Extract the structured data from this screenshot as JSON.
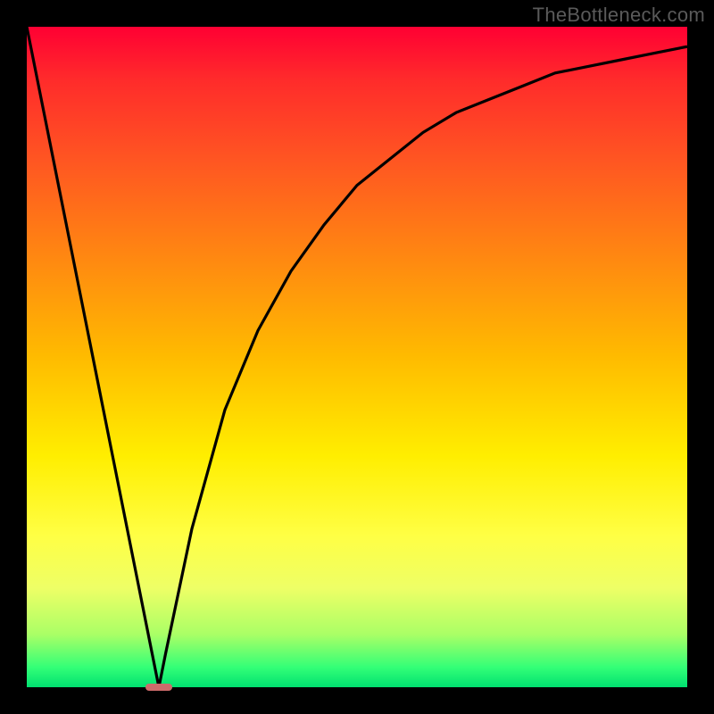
{
  "watermark": "TheBottleneck.com",
  "chart_data": {
    "type": "line",
    "title": "",
    "xlabel": "",
    "ylabel": "",
    "xlim": [
      0,
      100
    ],
    "ylim": [
      0,
      100
    ],
    "grid": false,
    "legend": false,
    "annotations": [],
    "series": [
      {
        "name": "curve",
        "x": [
          0,
          5,
          10,
          15,
          19,
          20,
          21,
          25,
          30,
          35,
          40,
          45,
          50,
          55,
          60,
          65,
          70,
          75,
          80,
          85,
          90,
          95,
          100
        ],
        "values": [
          100,
          75,
          50,
          25,
          5,
          0,
          5,
          24,
          42,
          54,
          63,
          70,
          76,
          80,
          84,
          87,
          89,
          91,
          93,
          94,
          95,
          96,
          97
        ]
      }
    ],
    "marker": {
      "x": 20,
      "y": 0,
      "width_frac": 0.04,
      "height_frac": 0.012
    }
  },
  "colors": {
    "curve_stroke": "#000000",
    "marker_fill": "#cc6b6b",
    "background_frame": "#000000"
  }
}
